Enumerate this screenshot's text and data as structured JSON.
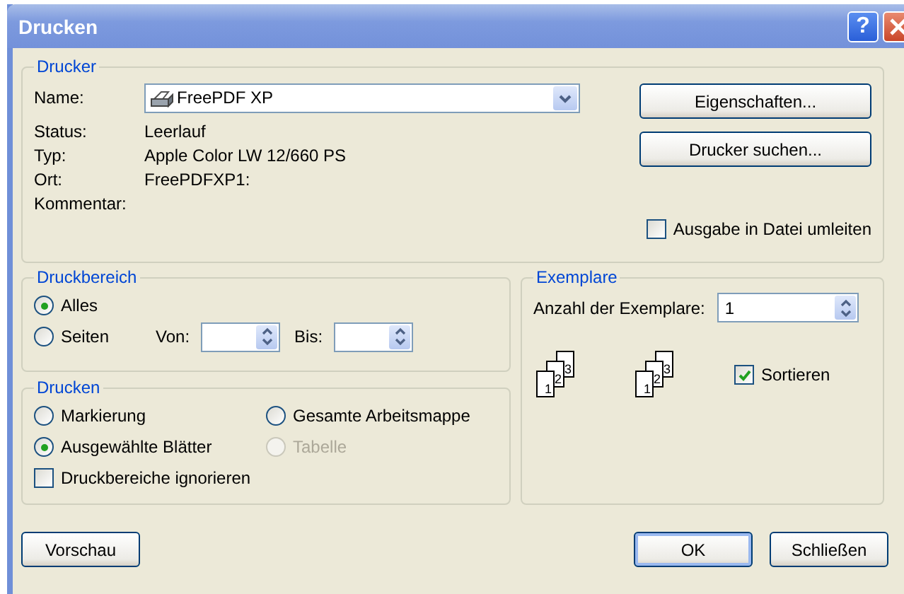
{
  "window": {
    "title": "Drucken",
    "help": "?"
  },
  "printer": {
    "legend": "Drucker",
    "name_label": "Name:",
    "name_value": "FreePDF XP",
    "info": [
      {
        "label": "Status:",
        "value": "Leerlauf"
      },
      {
        "label": "Typ:",
        "value": "Apple Color LW 12/660 PS"
      },
      {
        "label": "Ort:",
        "value": "FreePDFXP1:"
      },
      {
        "label": "Kommentar:"
      }
    ],
    "buttons": [
      "Eigenschaften...",
      "Drucker suchen..."
    ],
    "print_to_file": {
      "label": "Ausgabe in Datei umleiten",
      "checked": false
    }
  },
  "range": {
    "legend": "Druckbereich",
    "options": [
      {
        "label": "Alles",
        "selected": true
      },
      {
        "label": "Seiten",
        "selected": false
      }
    ],
    "from_label": "Von:",
    "to_label": "Bis:"
  },
  "print_what": {
    "legend": "Drucken",
    "options": [
      {
        "label": "Markierung",
        "selected": false,
        "disabled": false
      },
      {
        "label": "Gesamte Arbeitsmappe",
        "selected": false,
        "disabled": false
      },
      {
        "label": "Ausgewählte Blätter",
        "selected": true,
        "disabled": false
      },
      {
        "label": "Tabelle",
        "selected": false,
        "disabled": true
      }
    ],
    "ignore_areas": {
      "label": "Druckbereiche ignorieren",
      "checked": false
    }
  },
  "copies": {
    "legend": "Exemplare",
    "count_label": "Anzahl der Exemplare:",
    "count": "1",
    "stacks": [
      {
        "pages": [
          "1",
          "2",
          "3"
        ]
      },
      {
        "pages": [
          "1",
          "2",
          "3"
        ]
      }
    ],
    "collate": {
      "label": "Sortieren",
      "checked": true
    }
  },
  "footer": {
    "buttons": [
      {
        "label": "Vorschau",
        "kind": "left"
      },
      {
        "label": "OK",
        "kind": "default"
      },
      {
        "label": "Schließen",
        "kind": "normal"
      }
    ]
  }
}
